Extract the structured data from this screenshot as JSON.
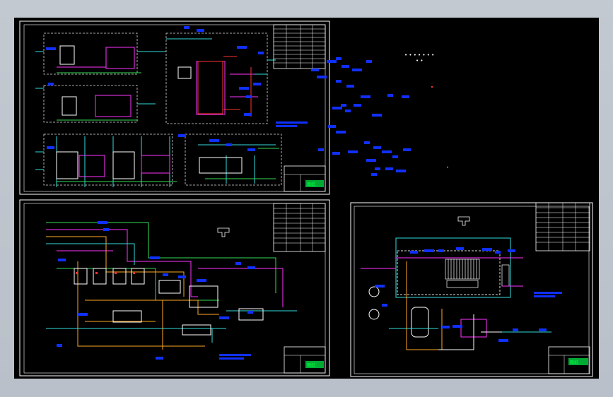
{
  "viewer": {
    "background": "#bfc5cd",
    "canvas": "#000000"
  },
  "sheets": [
    {
      "id": "top-left",
      "title_block_label": "图纸",
      "legend_rows": 11
    },
    {
      "id": "bottom-left",
      "title_block_label": "图纸",
      "legend_rows": 11
    },
    {
      "id": "bottom-right",
      "title_block_label": "图纸",
      "legend_rows": 10
    }
  ],
  "floating_notes": {
    "title_text": "• • • • • • •",
    "subtitle_text": "• •"
  },
  "colors": {
    "frame": "#ffffff",
    "pipe_green": "#33dd55",
    "pipe_magenta": "#ff33ff",
    "pipe_orange": "#ffaa22",
    "pipe_cyan": "#33dddd",
    "pipe_red": "#ff3333",
    "label_blue": "#1030ff",
    "text_green": "#00ff44"
  }
}
